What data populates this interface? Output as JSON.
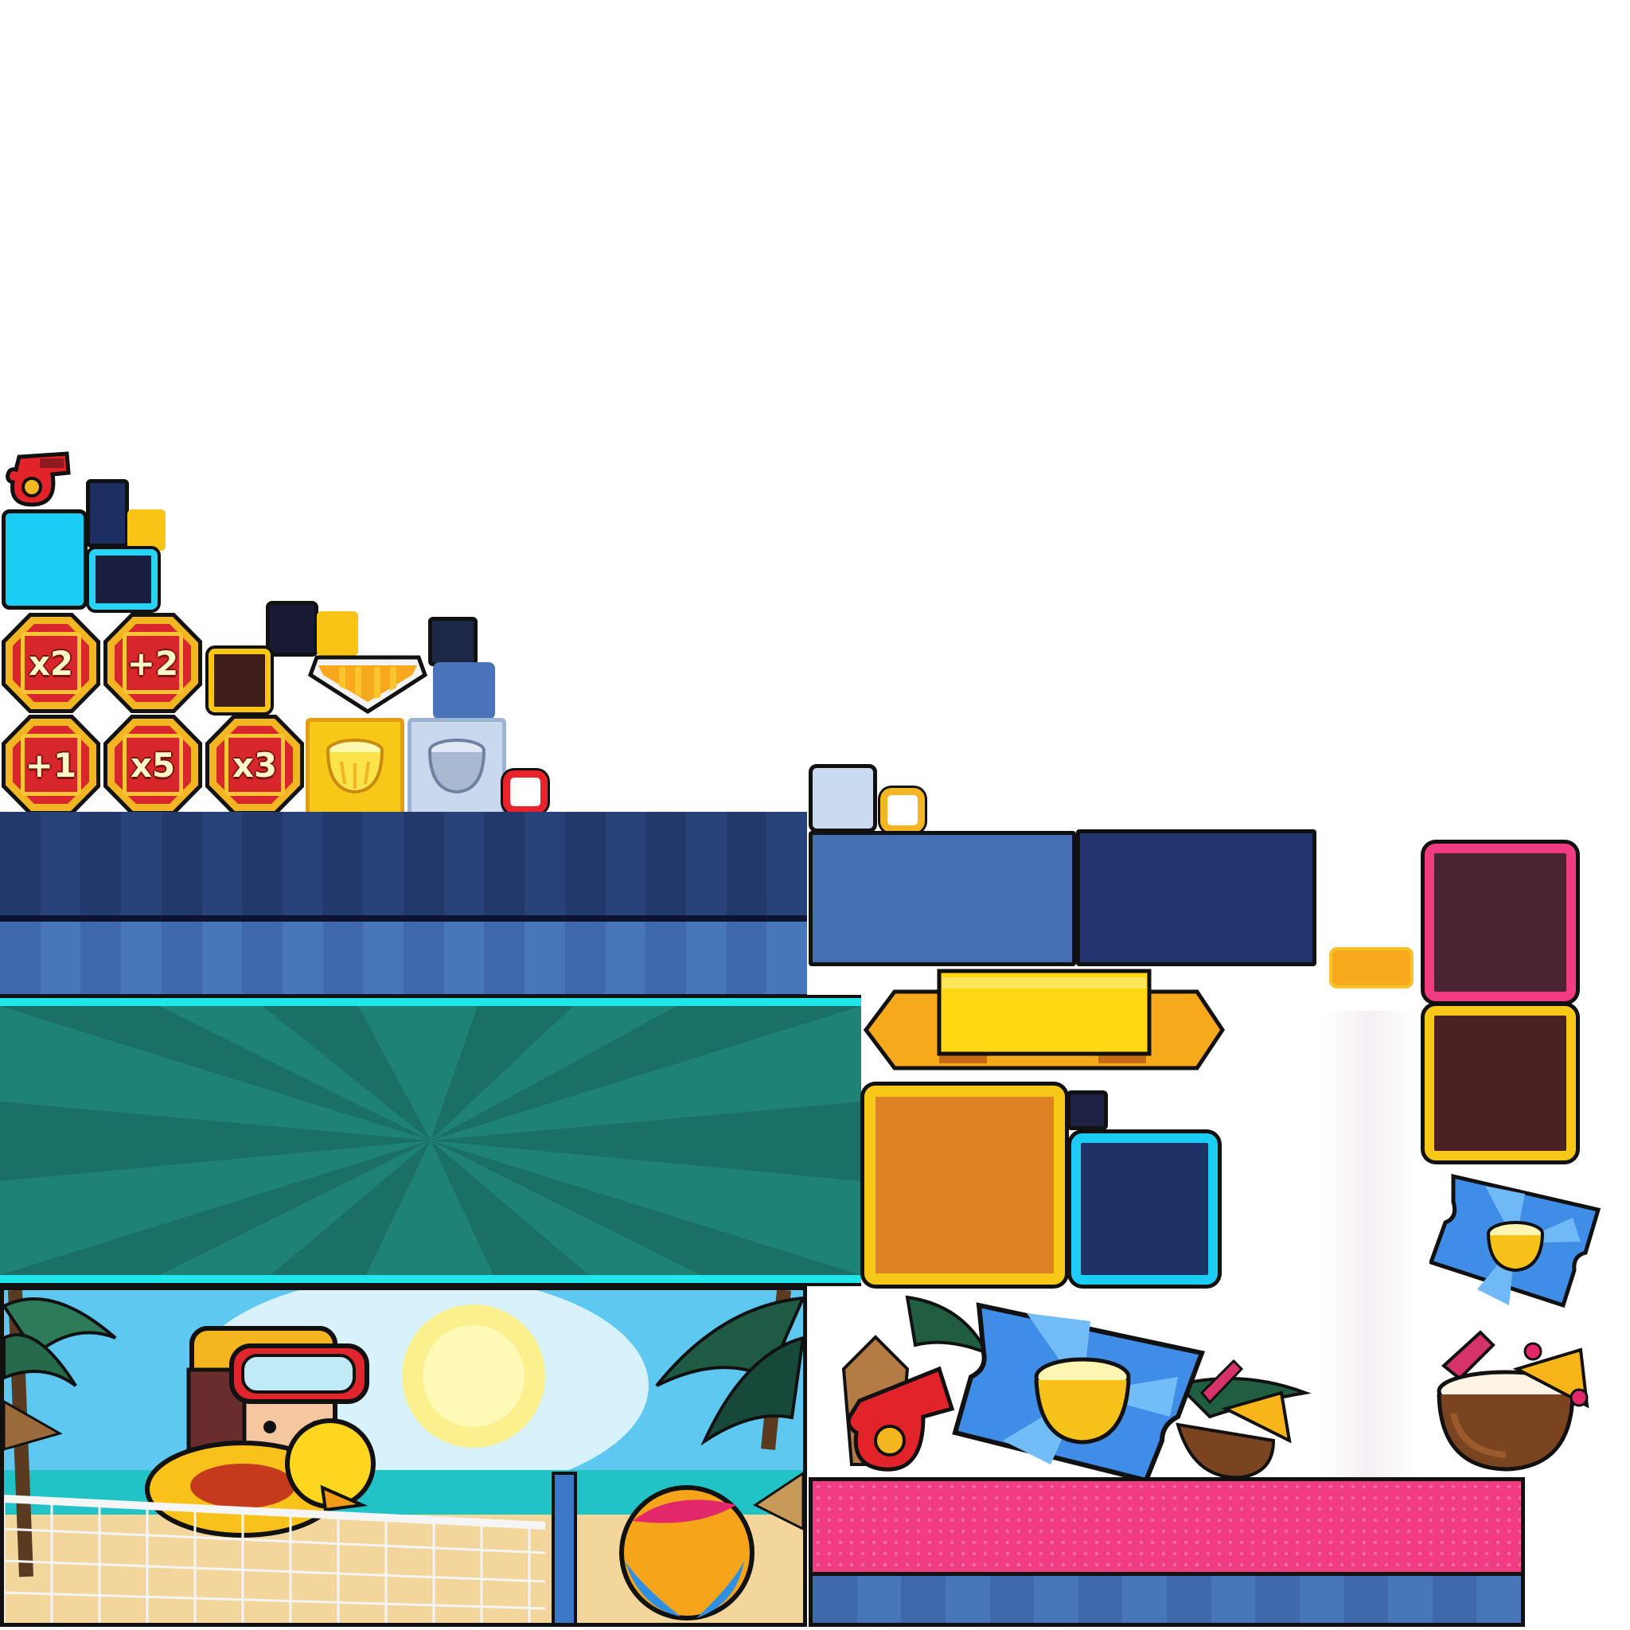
{
  "title": "",
  "multipliers": [
    {
      "id": "x2",
      "label": "x2"
    },
    {
      "id": "plus2",
      "label": "+2"
    },
    {
      "id": "plus1",
      "label": "+1"
    },
    {
      "id": "x5",
      "label": "x5"
    },
    {
      "id": "x3",
      "label": "x3"
    }
  ],
  "colors": {
    "navy_dark": "#263f75",
    "navy_mid": "#4470b3",
    "teal": "#1f8277",
    "teal_glow": "#1fe7e9",
    "cyan": "#1ccdf3",
    "gold": "#f8cf16",
    "orange": "#df8125",
    "pink": "#f23c82",
    "red": "#d8262d",
    "maroon": "#4b2432"
  },
  "icons": [
    "whistle-icon",
    "coconut-drink-icon",
    "beach-ball-icon",
    "ticket-icon",
    "palm-tree-icon",
    "duck-float-icon",
    "sun-icon",
    "volleyball-net-icon"
  ]
}
